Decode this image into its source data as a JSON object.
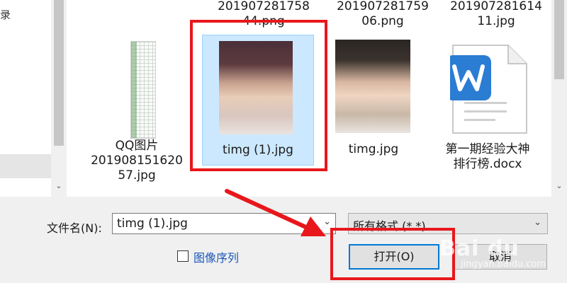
{
  "nav": {
    "fragment": "录"
  },
  "files": {
    "top_names": [
      "201907281758\n44.png",
      "201907281759\n06.png",
      "201907281614\n11.jpg"
    ],
    "items": [
      {
        "name": "QQ图片\n201908151620\n57.jpg"
      },
      {
        "name": "timg (1).jpg"
      },
      {
        "name": "timg.jpg"
      },
      {
        "name": "第一期经验大神\n排行榜.docx"
      }
    ]
  },
  "bottom": {
    "filename_label": "文件名(N):",
    "filename_value": "timg (1).jpg",
    "filetype_value": "所有格式 (*.*)",
    "preview_label": "图像序列",
    "open_label": "打开(O)",
    "cancel_label": "取消"
  },
  "icons": {
    "scroll_up": "scroll-up-icon",
    "scroll_down": "scroll-down-icon",
    "dropdown": "chevron-down-icon",
    "word": "word-document-icon"
  },
  "colors": {
    "annotation_red": "#e8171b",
    "selection": "#cce8ff",
    "word_blue": "#2b7cd3",
    "link_blue": "#1a57b8"
  },
  "watermark": {
    "brand": "Bai du",
    "sub": "jingyan.baidu.com"
  }
}
